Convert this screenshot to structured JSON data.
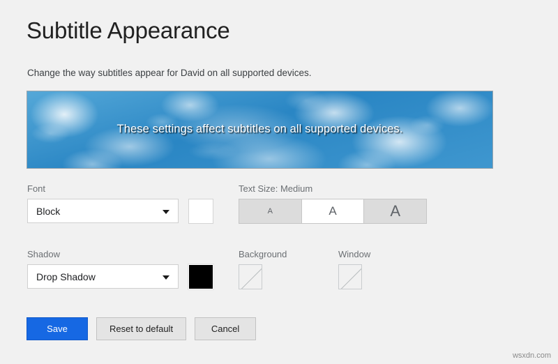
{
  "page": {
    "title": "Subtitle Appearance",
    "description": "Change the way subtitles appear for David on all supported devices.",
    "background_color": "#f1f1f1"
  },
  "preview": {
    "caption": "These settings affect subtitles on all supported devices.",
    "caption_color": "#ffffff",
    "sky_color": "#2f8ec9"
  },
  "controls": {
    "font": {
      "label": "Font",
      "value": "Block",
      "color_swatch": "#ffffff"
    },
    "text_size": {
      "label": "Text Size: Medium",
      "selected": "Medium",
      "options": [
        {
          "label": "A",
          "size": "Small",
          "selected": false
        },
        {
          "label": "A",
          "size": "Medium",
          "selected": true
        },
        {
          "label": "A",
          "size": "Large",
          "selected": false
        }
      ]
    },
    "shadow": {
      "label": "Shadow",
      "value": "Drop Shadow",
      "color_swatch": "#000000"
    },
    "background": {
      "label": "Background",
      "color_swatch": "none"
    },
    "window": {
      "label": "Window",
      "color_swatch": "none"
    }
  },
  "buttons": {
    "save": "Save",
    "reset": "Reset to default",
    "cancel": "Cancel",
    "save_color": "#1668e3"
  },
  "watermark": "wsxdn.com"
}
